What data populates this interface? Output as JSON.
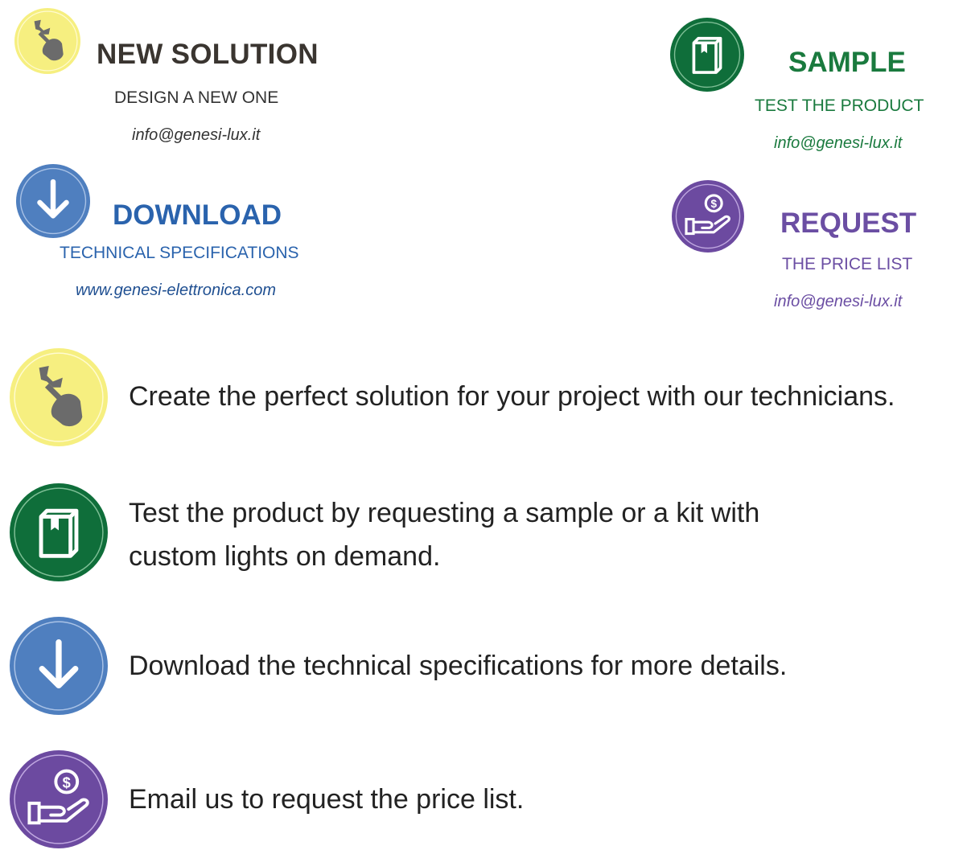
{
  "colors": {
    "yellow": "#f6ef80",
    "green": "#0f6e3a",
    "blue": "#4f7fbf",
    "purple": "#6c4aa0",
    "dark_text": "#3a3530",
    "blue_text": "#2a63ad",
    "green_text": "#1a7a3e",
    "purple_text": "#6b4ea3"
  },
  "cards": {
    "new_solution": {
      "icon": "wrench-hand-icon",
      "title": "NEW SOLUTION",
      "subtitle": "DESIGN A NEW ONE",
      "contact": "info@genesi-lux.it"
    },
    "download": {
      "icon": "arrow-down-icon",
      "title": "DOWNLOAD",
      "subtitle": "TECHNICAL SPECIFICATIONS",
      "contact": "www.genesi-elettronica.com"
    },
    "sample": {
      "icon": "box-icon",
      "title": "SAMPLE",
      "subtitle": "TEST THE PRODUCT",
      "contact": "info@genesi-lux.it"
    },
    "request": {
      "icon": "hand-coin-icon",
      "title": "REQUEST",
      "subtitle": "THE PRICE LIST",
      "contact": "info@genesi-lux.it"
    }
  },
  "features": [
    {
      "icon": "wrench-hand-icon",
      "text": "Create the perfect solution for your project with our technicians."
    },
    {
      "icon": "box-icon",
      "line1": "Test the product by requesting a sample or a kit with",
      "line2": "custom lights on demand."
    },
    {
      "icon": "arrow-down-icon",
      "text": "Download the technical specifications for more details."
    },
    {
      "icon": "hand-coin-icon",
      "text": "Email us to request the price list."
    }
  ]
}
